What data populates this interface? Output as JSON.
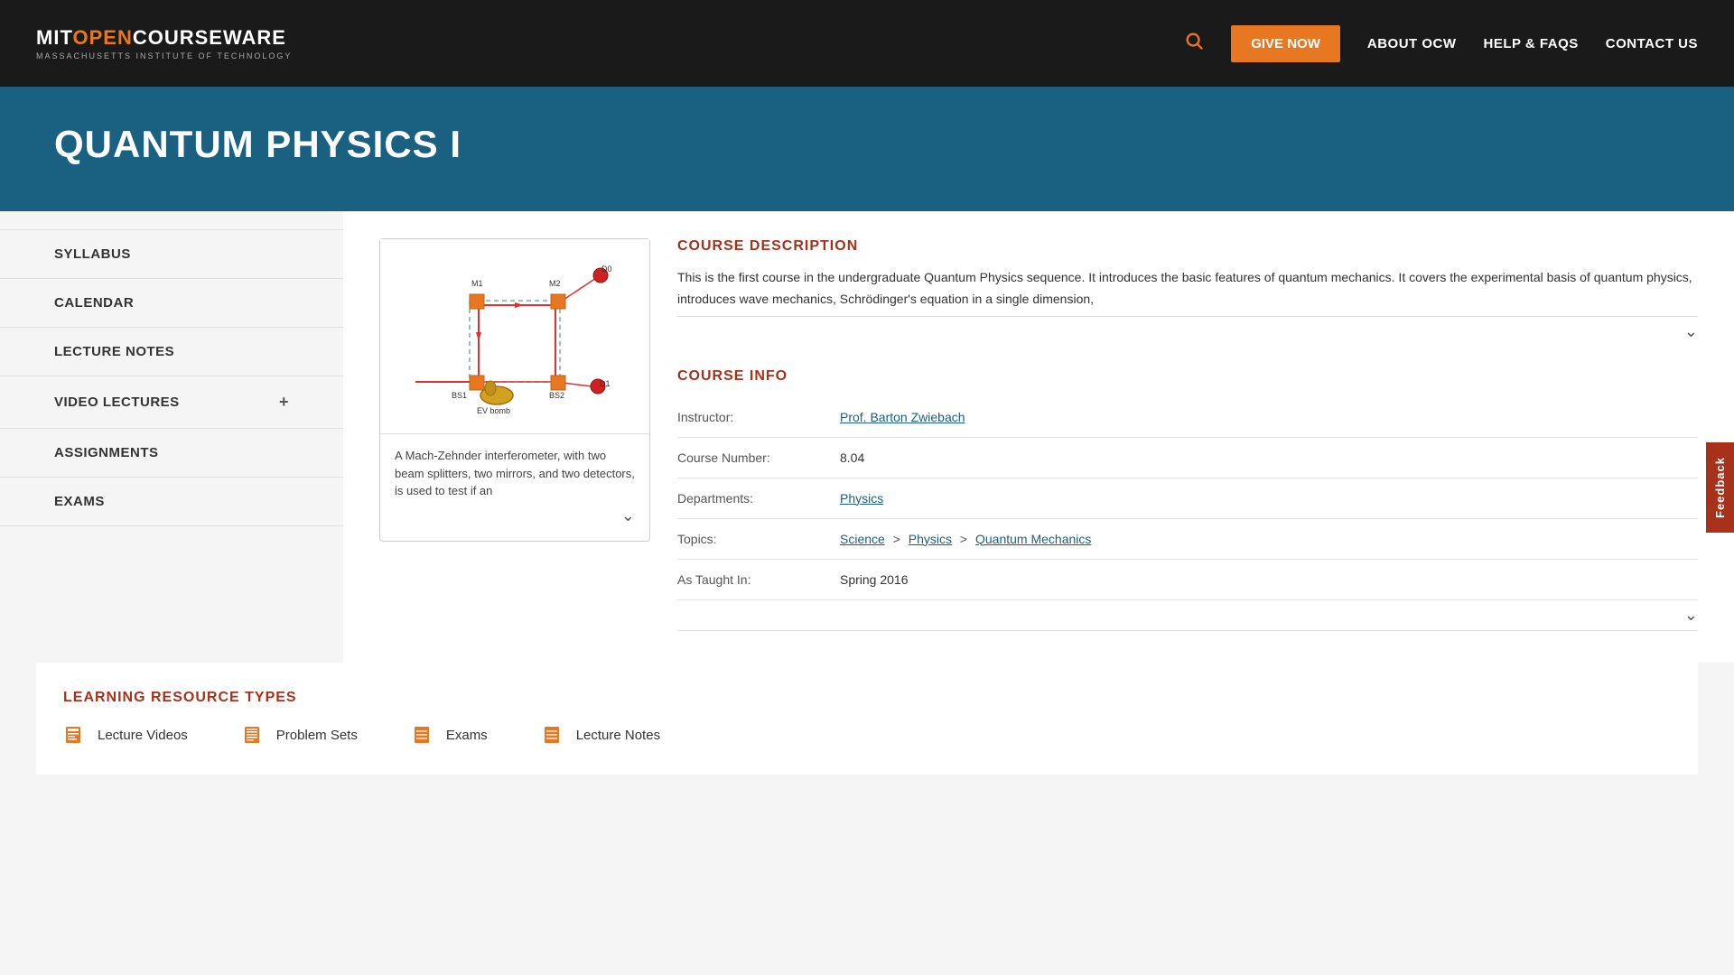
{
  "header": {
    "logo_mit": "MIT",
    "logo_open": "OPEN",
    "logo_courseware": "COURSEWARE",
    "logo_sub": "MASSACHUSETTS INSTITUTE OF TECHNOLOGY",
    "give_now_label": "GIVE NOW",
    "nav_items": [
      {
        "id": "about-ocw",
        "label": "ABOUT OCW"
      },
      {
        "id": "help-faqs",
        "label": "HELP & FAQS"
      },
      {
        "id": "contact-us",
        "label": "CONTACT US"
      }
    ]
  },
  "hero": {
    "title": "QUANTUM PHYSICS I"
  },
  "sidebar": {
    "items": [
      {
        "id": "syllabus",
        "label": "SYLLABUS",
        "has_expand": false
      },
      {
        "id": "calendar",
        "label": "CALENDAR",
        "has_expand": false
      },
      {
        "id": "lecture-notes",
        "label": "LECTURE NOTES",
        "has_expand": false
      },
      {
        "id": "video-lectures",
        "label": "VIDEO LECTURES",
        "has_expand": true
      },
      {
        "id": "assignments",
        "label": "ASSIGNMENTS",
        "has_expand": false
      },
      {
        "id": "exams",
        "label": "EXAMS",
        "has_expand": false
      }
    ]
  },
  "course_description": {
    "title": "COURSE DESCRIPTION",
    "text": "This is the first course in the undergraduate Quantum Physics sequence. It introduces the basic features of quantum mechanics. It covers the experimental basis of quantum physics, introduces wave mechanics, Schrödinger's equation in a single dimension,"
  },
  "course_info": {
    "title": "COURSE INFO",
    "instructor_label": "Instructor:",
    "instructor_name": "Prof. Barton Zwiebach",
    "course_number_label": "Course Number:",
    "course_number": "8.04",
    "departments_label": "Departments:",
    "department": "Physics",
    "topics_label": "Topics:",
    "topic_science": "Science",
    "topic_physics": "Physics",
    "topic_quantum": "Quantum Mechanics",
    "taught_in_label": "As Taught In:",
    "taught_in": "Spring 2016"
  },
  "image_caption": {
    "text": "A Mach-Zehnder interferometer, with two beam splitters, two mirrors, and two detectors, is used to test if an"
  },
  "learning_resources": {
    "title": "LEARNING RESOURCE TYPES",
    "items": [
      {
        "id": "lecture-videos",
        "icon": "▦",
        "label": "Lecture Videos"
      },
      {
        "id": "problem-sets",
        "icon": "▤",
        "label": "Problem Sets"
      },
      {
        "id": "exams",
        "icon": "≡",
        "label": "Exams"
      },
      {
        "id": "lecture-notes",
        "icon": "≡",
        "label": "Lecture Notes"
      }
    ]
  },
  "feedback": {
    "label": "Feedback"
  }
}
